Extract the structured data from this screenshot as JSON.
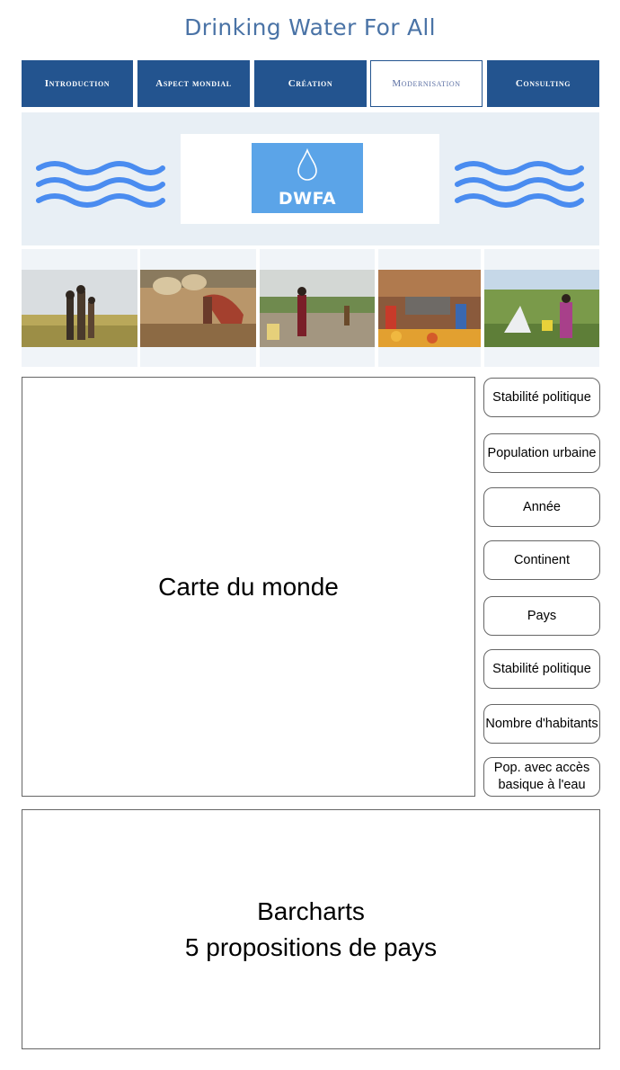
{
  "header": {
    "title": "Drinking Water For All"
  },
  "nav": {
    "tabs": [
      {
        "label": "Introduction",
        "active": false
      },
      {
        "label": "Aspect mondial",
        "active": false
      },
      {
        "label": "Création",
        "active": false
      },
      {
        "label": "Modernisation",
        "active": true
      },
      {
        "label": "Consulting",
        "active": false
      }
    ]
  },
  "banner": {
    "logo_text": "DWFA"
  },
  "map_panel": {
    "label": "Carte du monde"
  },
  "filters": [
    {
      "label": "Stabilité politique"
    },
    {
      "label": "Population urbaine"
    },
    {
      "label": "Année"
    },
    {
      "label": "Continent"
    },
    {
      "label": "Pays"
    },
    {
      "label": "Stabilité politique"
    },
    {
      "label": "Nombre d'habitants"
    },
    {
      "label": "Pop. avec accès basique à l'eau"
    }
  ],
  "barchart_panel": {
    "line1": "Barcharts",
    "line2": "5 propositions de pays"
  },
  "colors": {
    "nav": "#23548f",
    "title": "#4a73a6",
    "wave": "#4a8cf0",
    "logo": "#5ba4e8",
    "banner_bg": "#e8eff5"
  }
}
